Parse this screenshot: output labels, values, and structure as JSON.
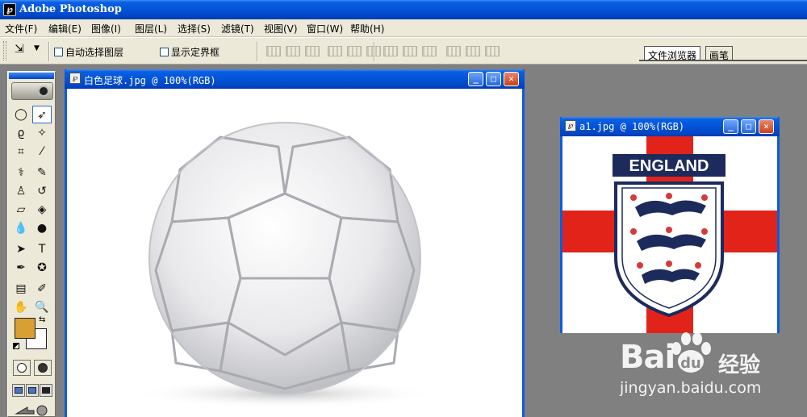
{
  "app": {
    "title": "Adobe Photoshop",
    "icon": "photoshop-app-icon"
  },
  "menu": {
    "items": [
      "文件(F)",
      "编辑(E)",
      "图像(I)",
      "图层(L)",
      "选择(S)",
      "滤镜(T)",
      "视图(V)",
      "窗口(W)",
      "帮助(H)"
    ]
  },
  "options": {
    "auto_select_label": "自动选择图层",
    "show_bounds_label": "显示定界框",
    "auto_select_checked": false,
    "show_bounds_checked": false
  },
  "palette_well": {
    "tabs": [
      "文件浏览器",
      "画笔"
    ]
  },
  "toolbox": {
    "foreground_color": "#d89f32",
    "background_color": "#ffffff"
  },
  "doc1": {
    "title": "白色足球.jpg @ 100%(RGB)",
    "content": "white-soccer-ball-image"
  },
  "doc2": {
    "title": "a1.jpg @ 100%(RGB)",
    "badge_text": "ENGLAND",
    "cross_color": "#e2231a",
    "crest_color": "#1d2b5c"
  },
  "watermark": {
    "brand": "Bai",
    "brand_cn": "经验",
    "url": "jingyan.baidu.com"
  },
  "window_controls": {
    "minimize": "_",
    "maximize": "□",
    "close": "✕"
  }
}
